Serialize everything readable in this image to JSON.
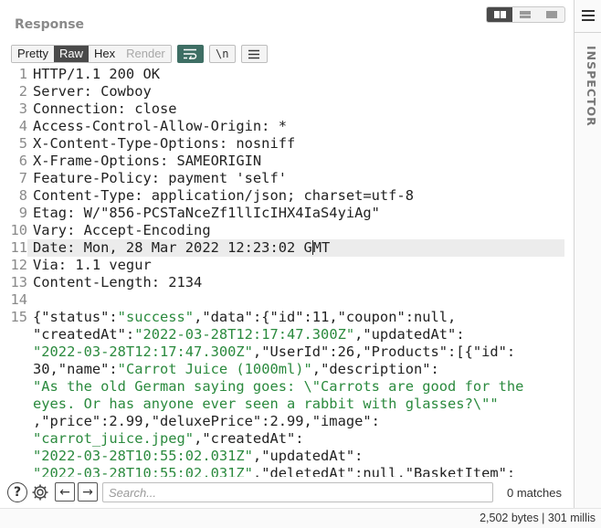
{
  "panel": {
    "title": "Response",
    "tabs": [
      {
        "label": "Pretty"
      },
      {
        "label": "Raw"
      },
      {
        "label": "Hex"
      },
      {
        "label": "Render"
      }
    ],
    "newline_toggle_label": "\\n"
  },
  "editor": {
    "lines": [
      {
        "num": "1",
        "text": "HTTP/1.1 200 OK"
      },
      {
        "num": "2",
        "text": "Server: Cowboy"
      },
      {
        "num": "3",
        "text": "Connection: close"
      },
      {
        "num": "4",
        "text": "Access-Control-Allow-Origin: *"
      },
      {
        "num": "5",
        "text": "X-Content-Type-Options: nosniff"
      },
      {
        "num": "6",
        "text": "X-Frame-Options: SAMEORIGIN"
      },
      {
        "num": "7",
        "text": "Feature-Policy: payment 'self'"
      },
      {
        "num": "8",
        "text": "Content-Type: application/json; charset=utf-8"
      },
      {
        "num": "9",
        "text": "Etag: W/\"856-PCSTaNceZf1llIcIHX4IaS4yiAg\""
      },
      {
        "num": "10",
        "text": "Vary: Accept-Encoding"
      },
      {
        "num": "11",
        "text_before_caret": "Date: Mon, 28 Mar 2022 12:23:02 G",
        "text_after_caret": "MT"
      },
      {
        "num": "12",
        "text": "Via: 1.1 vegur"
      },
      {
        "num": "13",
        "text": "Content-Length: 2134"
      },
      {
        "num": "14",
        "text": ""
      },
      {
        "num": "15",
        "text": ""
      }
    ],
    "json_body": [
      [
        [
          "k",
          "{\"status\":"
        ],
        [
          "s",
          "\"success\""
        ],
        [
          "k",
          ",\"data\":{\"id\":11,\"coupon\":null,"
        ]
      ],
      [
        [
          "k",
          "\"createdAt\":"
        ],
        [
          "s",
          "\"2022-03-28T12:17:47.300Z\""
        ],
        [
          "k",
          ",\"updatedAt\":"
        ]
      ],
      [
        [
          "s",
          "\"2022-03-28T12:17:47.300Z\""
        ],
        [
          "k",
          ",\"UserId\":26,\"Products\":[{\"id\":"
        ]
      ],
      [
        [
          "k",
          "30,\"name\":"
        ],
        [
          "s",
          "\"Carrot Juice (1000ml)\""
        ],
        [
          "k",
          ",\"description\":"
        ]
      ],
      [
        [
          "s",
          "\"As the old German saying goes: \\\"Carrots are good for the"
        ]
      ],
      [
        [
          "s",
          "eyes. Or has anyone ever seen a rabbit with glasses?\\\"\""
        ]
      ],
      [
        [
          "k",
          ",\"price\":2.99,\"deluxePrice\":2.99,\"image\":"
        ]
      ],
      [
        [
          "s",
          "\"carrot_juice.jpeg\""
        ],
        [
          "k",
          ",\"createdAt\":"
        ]
      ],
      [
        [
          "s",
          "\"2022-03-28T10:55:02.031Z\""
        ],
        [
          "k",
          ",\"updatedAt\":"
        ]
      ],
      [
        [
          "s",
          "\"2022-03-28T10:55:02.031Z\""
        ],
        [
          "k",
          ",\"deletedAt\":null,\"BasketItem\":"
        ]
      ]
    ]
  },
  "search": {
    "placeholder": "Search...",
    "value": "",
    "matches": "0 matches"
  },
  "status": {
    "text": "2,502 bytes | 301 millis"
  },
  "inspector": {
    "label": "INSPECTOR"
  },
  "colors": {
    "accent_active_tab": "#4a4a4a",
    "wrap_toggle_active": "#3e6e64",
    "json_string": "#2b8a3e"
  }
}
